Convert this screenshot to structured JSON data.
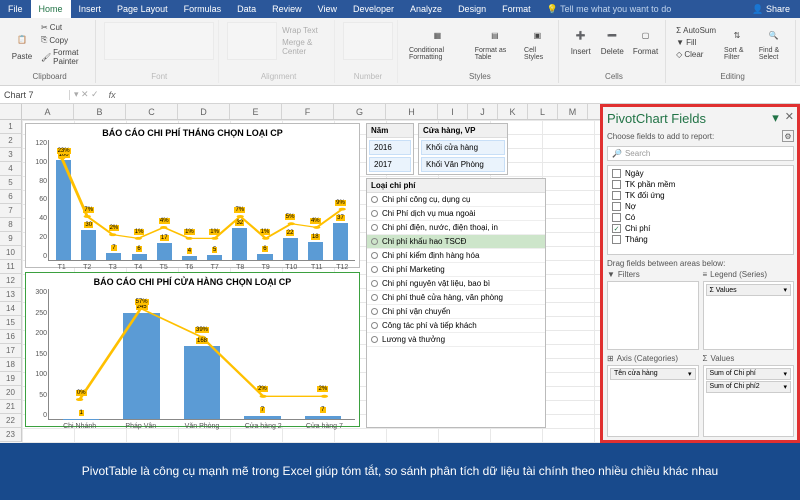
{
  "tabs": [
    "File",
    "Home",
    "Insert",
    "Page Layout",
    "Formulas",
    "Data",
    "Review",
    "View",
    "Developer",
    "Analyze",
    "Design",
    "Format"
  ],
  "active_tab": "Home",
  "tell_me": "Tell me what you want to do",
  "share": "Share",
  "ribbon": {
    "clipboard": {
      "label": "Clipboard",
      "paste": "Paste",
      "cut": "Cut",
      "copy": "Copy",
      "painter": "Format Painter"
    },
    "font": {
      "label": "Font"
    },
    "align": {
      "label": "Alignment",
      "wrap": "Wrap Text",
      "merge": "Merge & Center"
    },
    "number": {
      "label": "Number"
    },
    "styles": {
      "label": "Styles",
      "cond": "Conditional Formatting",
      "table": "Format as Table",
      "cell": "Cell Styles"
    },
    "cells": {
      "label": "Cells",
      "insert": "Insert",
      "delete": "Delete",
      "format": "Format"
    },
    "editing": {
      "label": "Editing",
      "sum": "AutoSum",
      "fill": "Fill",
      "clear": "Clear",
      "sort": "Sort & Filter",
      "find": "Find & Select"
    }
  },
  "name_box": "Chart 7",
  "columns": [
    "A",
    "B",
    "C",
    "D",
    "E",
    "F",
    "G",
    "H",
    "I",
    "J",
    "K",
    "L",
    "M"
  ],
  "rows": [
    "1",
    "2",
    "3",
    "4",
    "5",
    "6",
    "7",
    "8",
    "9",
    "10",
    "11",
    "12",
    "13",
    "14",
    "15",
    "16",
    "17",
    "18",
    "19",
    "20",
    "21",
    "22",
    "23"
  ],
  "chart_data": [
    {
      "type": "bar+line",
      "title": "BÁO CÁO CHI PHÍ THÁNG CHỌN LOẠI CP",
      "categories": [
        "T1",
        "T2",
        "T3",
        "T4",
        "T5",
        "T6",
        "T7",
        "T8",
        "T9",
        "T10",
        "T11",
        "T12"
      ],
      "values": [
        100,
        30,
        7,
        6,
        17,
        4,
        5,
        32,
        6,
        22,
        18,
        37
      ],
      "line_pct": [
        23,
        7,
        2,
        1,
        4,
        1,
        1,
        7,
        1,
        5,
        4,
        9
      ],
      "ylim": [
        0,
        120
      ],
      "yticks": [
        0,
        20,
        40,
        60,
        80,
        100,
        120
      ]
    },
    {
      "type": "bar+line",
      "title": "BÁO CÁO CHI PHÍ CỬA HÀNG CHỌN LOẠI CP",
      "categories": [
        "Chi Nhánh",
        "Pháp Vân",
        "Văn Phòng",
        "Cửa hàng 2",
        "Cửa hàng 7"
      ],
      "values": [
        1,
        245,
        168,
        7,
        7
      ],
      "line_pct": [
        0,
        57,
        39,
        2,
        2
      ],
      "ylim": [
        0,
        300
      ],
      "yticks": [
        0,
        50,
        100,
        150,
        200,
        250,
        300
      ]
    }
  ],
  "slicers": {
    "year": {
      "title": "Năm",
      "items": [
        "2016",
        "2017"
      ]
    },
    "store": {
      "title": "Cửa hàng, VP",
      "items": [
        "Khối cửa hàng",
        "Khối Văn Phòng"
      ]
    }
  },
  "cost_types": {
    "title": "Loại chi phí",
    "items": [
      "Chi phí công cụ, dụng cụ",
      "Chi Phí dịch vụ mua ngoài",
      "Chi phí điện, nước, điện thoại, in",
      "Chi phí khấu hao TSCĐ",
      "Chi phí kiểm định hàng hóa",
      "Chi phí Marketing",
      "Chi phí nguyên vật liệu, bao bì",
      "Chi phí thuê cửa hàng, văn phòng",
      "Chi phí vận chuyển",
      "Công tác phí và tiếp khách",
      "Lương và thưởng"
    ],
    "selected_index": 3
  },
  "pane": {
    "title": "PivotChart Fields",
    "subtitle": "Choose fields to add to report:",
    "search_placeholder": "Search",
    "fields": [
      {
        "label": "Ngày",
        "checked": false
      },
      {
        "label": "TK phần mềm",
        "checked": false
      },
      {
        "label": "TK đối ứng",
        "checked": false
      },
      {
        "label": "Nợ",
        "checked": false
      },
      {
        "label": "Có",
        "checked": false
      },
      {
        "label": "Chi phí",
        "checked": true
      },
      {
        "label": "Tháng",
        "checked": false
      }
    ],
    "drag_label": "Drag fields between areas below:",
    "areas": {
      "filters": {
        "label": "Filters",
        "items": []
      },
      "legend": {
        "label": "Legend (Series)",
        "sub": "Σ Values",
        "items": [
          "Σ Values"
        ]
      },
      "axis": {
        "label": "Axis (Categories)",
        "items": [
          "Tên cửa hàng"
        ]
      },
      "values": {
        "label": "Values",
        "items": [
          "Sum of Chi phí",
          "Sum of Chi phí2"
        ]
      }
    }
  },
  "footer_text": "PivotTable là công cụ mạnh mẽ trong Excel giúp tóm tắt, so sánh phân tích dữ liệu tài chính theo nhiều chiều khác nhau"
}
